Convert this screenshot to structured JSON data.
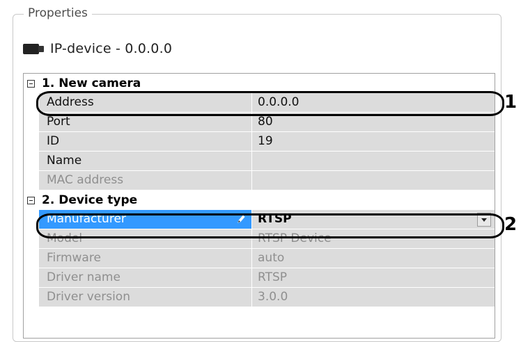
{
  "properties": {
    "legend": "Properties",
    "device_title": "IP-device - 0.0.0.0"
  },
  "grid": {
    "sections": [
      {
        "label": "1. New camera",
        "rows": [
          {
            "name": "Address",
            "value": "0.0.0.0"
          },
          {
            "name": "Port",
            "value": "80"
          },
          {
            "name": "ID",
            "value": "19"
          },
          {
            "name": "Name",
            "value": ""
          },
          {
            "name": "MAC address",
            "value": ""
          }
        ]
      },
      {
        "label": "2. Device type",
        "rows": [
          {
            "name": "Manufacturer",
            "value": "RTSP"
          },
          {
            "name": "Model",
            "value": "RTSP Device"
          },
          {
            "name": "Firmware",
            "value": "auto"
          },
          {
            "name": "Driver name",
            "value": "RTSP"
          },
          {
            "name": "Driver version",
            "value": "3.0.0"
          }
        ]
      }
    ]
  },
  "callouts": [
    "1",
    "2"
  ],
  "icons": {
    "collapse": "minus-box-icon",
    "camera": "camera-icon",
    "edit": "pencil-icon",
    "dropdown": "chevron-down-icon"
  },
  "colors": {
    "selected_bg": "#3399ff",
    "row_bg": "#dcdcdc",
    "disabled_text": "#8f8f8f"
  }
}
